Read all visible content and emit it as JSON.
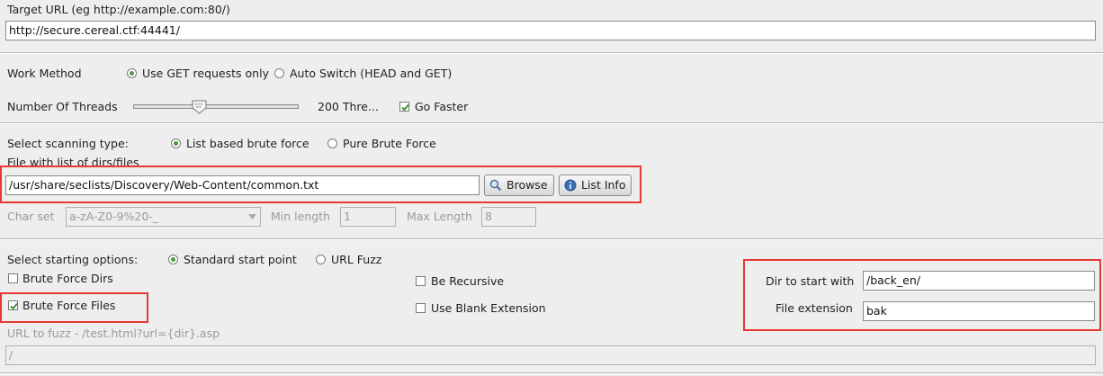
{
  "target": {
    "label": "Target URL (eg http://example.com:80/)",
    "value": "http://secure.cereal.ctf:44441/"
  },
  "work_method": {
    "label": "Work Method",
    "options": [
      "Use GET requests only",
      "Auto Switch (HEAD and GET)"
    ],
    "selected": "Use GET requests only"
  },
  "threads": {
    "label": "Number Of Threads",
    "value_text": "200 Thre...",
    "go_faster_label": "Go Faster",
    "go_faster_checked": true
  },
  "scan_type": {
    "label": "Select scanning type:",
    "options": [
      "List based brute force",
      "Pure Brute Force"
    ],
    "selected": "List based brute force"
  },
  "file_list": {
    "label": "File with list of dirs/files",
    "value": "/usr/share/seclists/Discovery/Web-Content/common.txt",
    "browse_label": "Browse",
    "list_info_label": "List Info"
  },
  "charset": {
    "label": "Char set",
    "value": "a-zA-Z0-9%20-_",
    "min_label": "Min length",
    "min_value": "1",
    "max_label": "Max Length",
    "max_value": "8"
  },
  "start": {
    "label": "Select starting options:",
    "options": [
      "Standard start point",
      "URL Fuzz"
    ],
    "selected": "Standard start point",
    "brute_dirs_label": "Brute Force Dirs",
    "brute_dirs_checked": false,
    "brute_files_label": "Brute Force Files",
    "brute_files_checked": true,
    "recursive_label": "Be Recursive",
    "recursive_checked": false,
    "blank_ext_label": "Use Blank Extension",
    "blank_ext_checked": false,
    "dir_label": "Dir to start with",
    "dir_value": "/back_en/",
    "ext_label": "File extension",
    "ext_value": "bak"
  },
  "fuzz": {
    "label": "URL to fuzz - /test.html?url={dir}.asp",
    "value": "/"
  },
  "colors": {
    "highlight": "#e53935",
    "radio_dot": "#4a9a3a",
    "check_mark": "#3a8a2a"
  }
}
